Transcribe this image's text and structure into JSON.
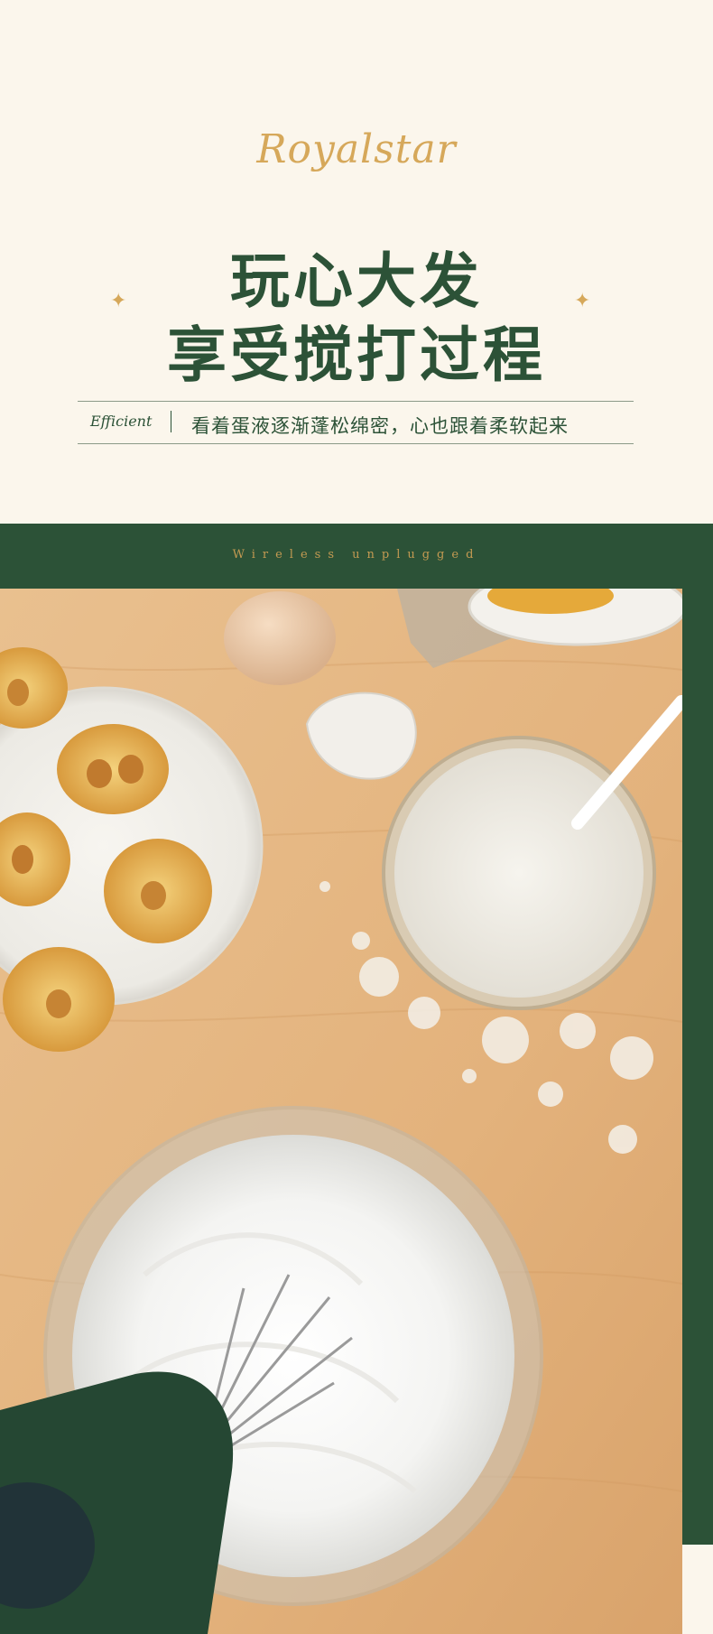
{
  "brand": {
    "logo_text": "Royalstar"
  },
  "headline": {
    "line1": "玩心大发",
    "line2": "享受搅打过程"
  },
  "tagline": {
    "label": "Efficient",
    "text": "看着蛋液逐渐蓬松绵密，心也跟着柔软起来"
  },
  "subheading": "Wireless unplugged",
  "decor": {
    "sparkle": "✦"
  },
  "colors": {
    "accent_green": "#2c5237",
    "gold": "#d6a85a",
    "cream": "#fbf6ec",
    "wood": "#e6b98a"
  }
}
